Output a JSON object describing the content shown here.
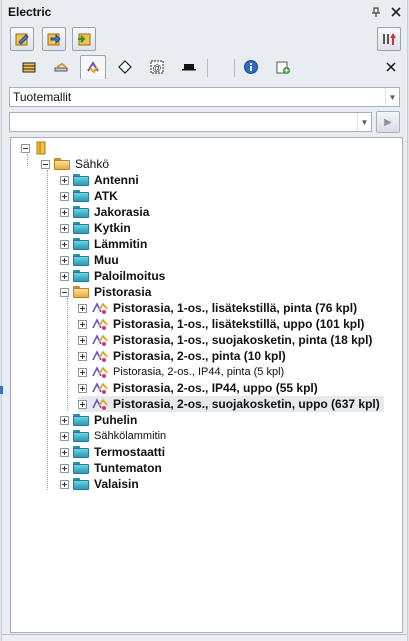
{
  "window": {
    "title": "Electric",
    "pin_icon": "pin-icon",
    "close_icon": "close-icon"
  },
  "combo1": {
    "value": "Tuotemallit"
  },
  "combo2": {
    "value": ""
  },
  "tree": {
    "root_label": "",
    "category": "Sähkö",
    "items": [
      {
        "label": "Antenni",
        "bold": true
      },
      {
        "label": "ATK",
        "bold": true
      },
      {
        "label": "Jakorasia",
        "bold": true
      },
      {
        "label": "Kytkin",
        "bold": true
      },
      {
        "label": "Lämmitin",
        "bold": true
      },
      {
        "label": "Muu",
        "bold": true
      },
      {
        "label": "Paloilmoitus",
        "bold": true
      },
      {
        "label": "Pistorasia",
        "bold": true,
        "open": true
      },
      {
        "label": "Puhelin",
        "bold": true
      },
      {
        "label": "Sähkölammitin",
        "bold": false
      },
      {
        "label": "Termostaatti",
        "bold": true
      },
      {
        "label": "Tuntematon",
        "bold": true
      },
      {
        "label": "Valaisin",
        "bold": true
      }
    ],
    "pistorasia_children": [
      {
        "label": "Pistorasia, 1-os., lisätekstillä, pinta (76 kpl)",
        "bold": true
      },
      {
        "label": "Pistorasia, 1-os., lisätekstillä, uppo (101 kpl)",
        "bold": true
      },
      {
        "label": "Pistorasia, 1-os., suojakosketin, pinta (18 kpl)",
        "bold": true
      },
      {
        "label": "Pistorasia, 2-os., pinta (10 kpl)",
        "bold": true
      },
      {
        "label": "Pistorasia, 2-os., IP44, pinta (5 kpl)",
        "bold": false
      },
      {
        "label": "Pistorasia, 2-os., IP44, uppo (55 kpl)",
        "bold": true
      },
      {
        "label": "Pistorasia, 2-os., suojakosketin, uppo (637 kpl)",
        "bold": true,
        "selected": true
      }
    ]
  },
  "colors": {
    "folder_teal": "#2a9ab6",
    "folder_open": "#e7a83e",
    "panel_bg": "#e9ecf1"
  }
}
